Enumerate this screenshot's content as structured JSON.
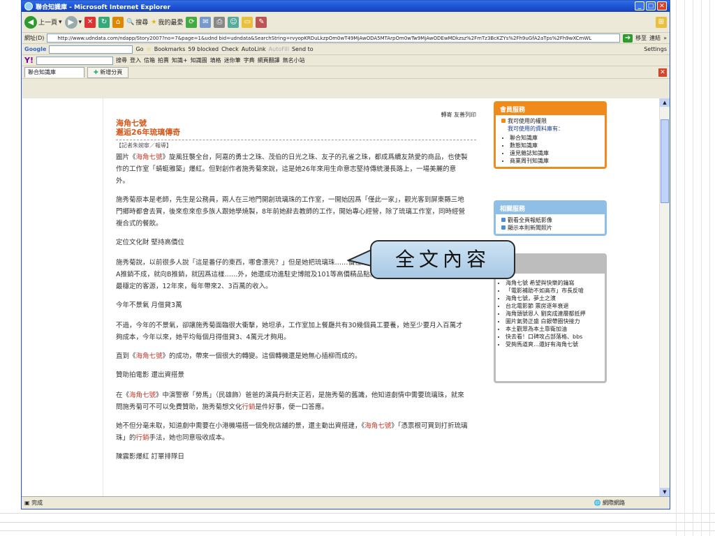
{
  "window": {
    "title": "聯合知識庫 - Microsoft Internet Explorer"
  },
  "toolbar": {
    "back": "上一頁",
    "search": "搜尋",
    "favorites": "我的最愛"
  },
  "address": {
    "label": "網址(D)",
    "url": "http://www.udndata.com/ndapp/Story2007?no=7&page=1&udnd bid=udndata&SearchString=rvyopKRDuLkzpOm0wT49MjAwODA5MTArpOm0wTw9MjAwODEwMDkzsz%2FmTz3BcKZYs%2Fh9uGfA2aTps%2Fh9wXCmWL",
    "go": "移至",
    "links": "連結"
  },
  "google_bar": {
    "label": "Google",
    "go": "Go",
    "bookmarks": "Bookmarks",
    "blocked": "59 blocked",
    "check": "Check",
    "autolink": "AutoLink",
    "autofill": "AutoFill",
    "send": "Send to",
    "settings": "Settings"
  },
  "yahoo_bar": {
    "search": "搜尋",
    "login": "登入",
    "mail": "信箱",
    "auction": "拍賣",
    "knowledge": "知識+",
    "kmap": "知識圖",
    "blog": "填格",
    "mini": "迷你筆",
    "dict": "字典",
    "translate": "網頁翻譯",
    "nameless": "無名小站"
  },
  "tabs": {
    "current": "聯合知識庫",
    "new": "新增分頁"
  },
  "status": {
    "left": "完成",
    "right": "網際網路"
  },
  "article": {
    "links": "轉寄 友善列印",
    "title1": "海角七號",
    "title2": "邂逅26年琉璃傳奇",
    "source": "【記者朱婉寧／報導】",
    "p1": "圖片《海角七號》旋風狂襲全台，阿嘉的勇士之珠、茂伯的日光之珠、友子的孔雀之珠，都成爲續友熱愛的商品，也使製作的工作室「蜻蜓雅築」爆紅。但對創作者施秀菊來說，這是她26年來用生命意志堅持傳統漫長路上，一場美麗的意外。",
    "p2": "施秀菊原本是老師，先生是公務員，兩人在三地門開創琉璃珠的工作室，一開始因爲「僅此一家」，觀光客到屏東縣三地門鄉時都會去買，後來愈來愈多族人跟她學燒製，8年前她辭去教師的工作，開始專心經營，除了琉璃工作室，同時經營複合式的餐飲。",
    "h1": "定位文化財 堅持高價位",
    "p3": "施秀菊說，以前很多人說「這是番仔的東西，哪會漂亮？」但是她把琉璃珠……價位路線，不斷向難鋪點的地方叩關，向A推銷不成，就向B推銷，就因爲這樣……外，她還成功進駐史博館及101等高價精品點。連最挑剔的日本客戶也成爲她最穩定的客源，12年來，每年帶來2、3百萬的收入。",
    "h2": "今年不景氣 月借貸3萬",
    "p4": "不過，今年的不景氣，卻讓施秀菊面臨很大衝擊，她坦承，工作室加上餐廳共有30幾個員工要養，她至少要月入百萬才夠成本，今年以來，她平均每個月得借貸3、4萬元才夠用。",
    "p5": "直到《海角七號》的成功，帶來一個很大的轉變。這個轉機還是她無心插柳而成的。",
    "h3": "贊助拍電影 還出資搭景",
    "p6": "在《海角七號》中演警察「勞馬」（民雄飾）爸爸的演員丹耐夫正若，是施秀菊的舊識，他知道劇情中需要琉璃珠，就來問施秀菊可不可以免費贊助，施秀菊想文化行銷是件好事，便一口答應。",
    "p7": "她不但分毫未取，知道劇中需要在小港機場搭一個免稅店舖的景，還主動出資搭建，《海角七號》「憑票根可買到打折琉璃珠」的行銷手法，她也同意吸收成本。",
    "p8": "陳震影爆紅 訂單排隊日"
  },
  "member": {
    "header": "會員服務",
    "link1": "我可使用的權限",
    "link2": "我可使用的資料庫有：",
    "dbs": [
      "聯合知識庫",
      "數態知識庫",
      "遠見雜誌知識庫",
      "商業周刊知識庫"
    ]
  },
  "related": {
    "header": "相關服務",
    "items": [
      "觀看全頁報紙影像",
      "顯示本則新聞照片"
    ]
  },
  "news_list": [
    "海角七號 希望與快樂的鑰寫",
    "「電影補助不如高市」市長反嗆",
    "海角七號，夢土之濱",
    "台北電影節 票房逐年衰退",
    "海角頭號恩人 劉奕成連層都抵押",
    "圖片氣勢正盛 白銀帶圈快接力",
    "本土觀眾為本土靠衛加油",
    "快去看！口碑攻占部落格、bbs",
    "受夠馬道爽…還好有海角七號"
  ],
  "callout": {
    "text": "全文內容"
  }
}
